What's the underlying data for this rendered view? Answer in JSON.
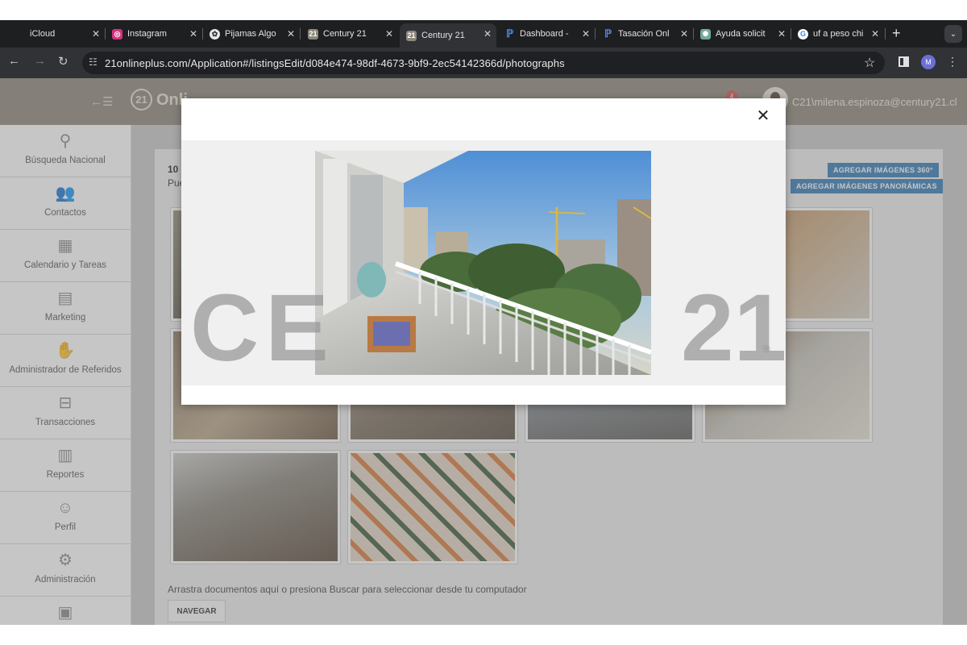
{
  "browser": {
    "tabs": [
      {
        "label": "iCloud",
        "icon": "apple-icon"
      },
      {
        "label": "Instagram",
        "icon": "instagram-icon"
      },
      {
        "label": "Pijamas Algo",
        "icon": "chatgpt-icon"
      },
      {
        "label": "Century 21",
        "icon": "century21-icon"
      },
      {
        "label": "Century 21",
        "icon": "century21-icon"
      },
      {
        "label": "Dashboard -",
        "icon": "p-icon"
      },
      {
        "label": "Tasación Onl",
        "icon": "p-icon"
      },
      {
        "label": "Ayuda solicit",
        "icon": "openai-icon"
      },
      {
        "label": "uf a peso chi",
        "icon": "google-icon"
      }
    ],
    "active_tab_index": 4,
    "url": "21onlineplus.com/Application#/listingsEdit/d084e474-98df-4673-9bf9-2ec54142366d/photographs",
    "profile_initial": "M"
  },
  "app": {
    "logo_text": "Onli",
    "notification_count": "4",
    "user": "C21\\milena.espinoza@century21.cl",
    "accent_color": "#8d877a"
  },
  "sidebar": {
    "items": [
      {
        "label": "Búsqueda Nacional",
        "icon": "search-icon"
      },
      {
        "label": "Contactos",
        "icon": "contacts-icon"
      },
      {
        "label": "Calendario y Tareas",
        "icon": "calendar-icon"
      },
      {
        "label": "Marketing",
        "icon": "book-icon"
      },
      {
        "label": "Administrador de Referidos",
        "icon": "handshake-icon"
      },
      {
        "label": "Transacciones",
        "icon": "briefcase-icon"
      },
      {
        "label": "Reportes",
        "icon": "bar-chart-icon"
      },
      {
        "label": "Perfil",
        "icon": "user-icon"
      },
      {
        "label": "Administración",
        "icon": "gear-icon"
      },
      {
        "label": "",
        "icon": "store-icon"
      }
    ]
  },
  "listing": {
    "title_partial": "10",
    "subtitle_partial": "Pue",
    "btn_360": "AGREGAR IMÁGENES 360°",
    "btn_panoramic": "AGREGAR IMÁGENES PANORÁMICAS",
    "drag_text": "Arrastra documentos aquí o presiona Buscar para seleccionar desde tu computador",
    "navigate_btn": "NAVEGAR"
  },
  "modal": {
    "watermark_left": "CE",
    "watermark_right": "21",
    "watermark_registered": "®",
    "close_label": "✕"
  }
}
